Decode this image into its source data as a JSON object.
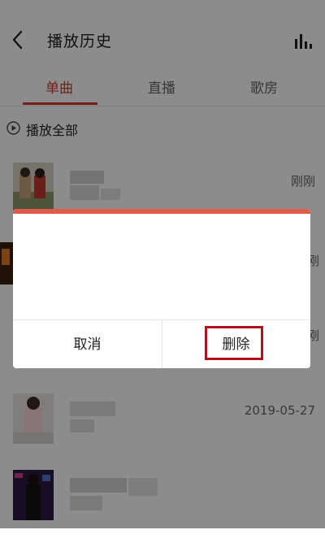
{
  "header": {
    "title": "播放历史",
    "back_icon": "chevron-left-icon",
    "chart_icon": "bars-icon"
  },
  "tabs": [
    {
      "label": "单曲",
      "active": true
    },
    {
      "label": "直播",
      "active": false
    },
    {
      "label": "歌房",
      "active": false
    }
  ],
  "play_all": {
    "label": "播放全部",
    "icon": "play-circle-icon"
  },
  "list": [
    {
      "meta": "刚刚"
    },
    {
      "meta": "刚"
    },
    {
      "meta": "刚"
    },
    {
      "meta": "2019-05-27"
    },
    {
      "meta": ""
    }
  ],
  "dialog": {
    "cancel_label": "取消",
    "delete_label": "删除",
    "accent_color": "#e05a4c",
    "highlight_color": "#b3101a"
  },
  "colors": {
    "accent": "#d33a31",
    "overlay": "rgba(0,0,0,0.45)"
  }
}
